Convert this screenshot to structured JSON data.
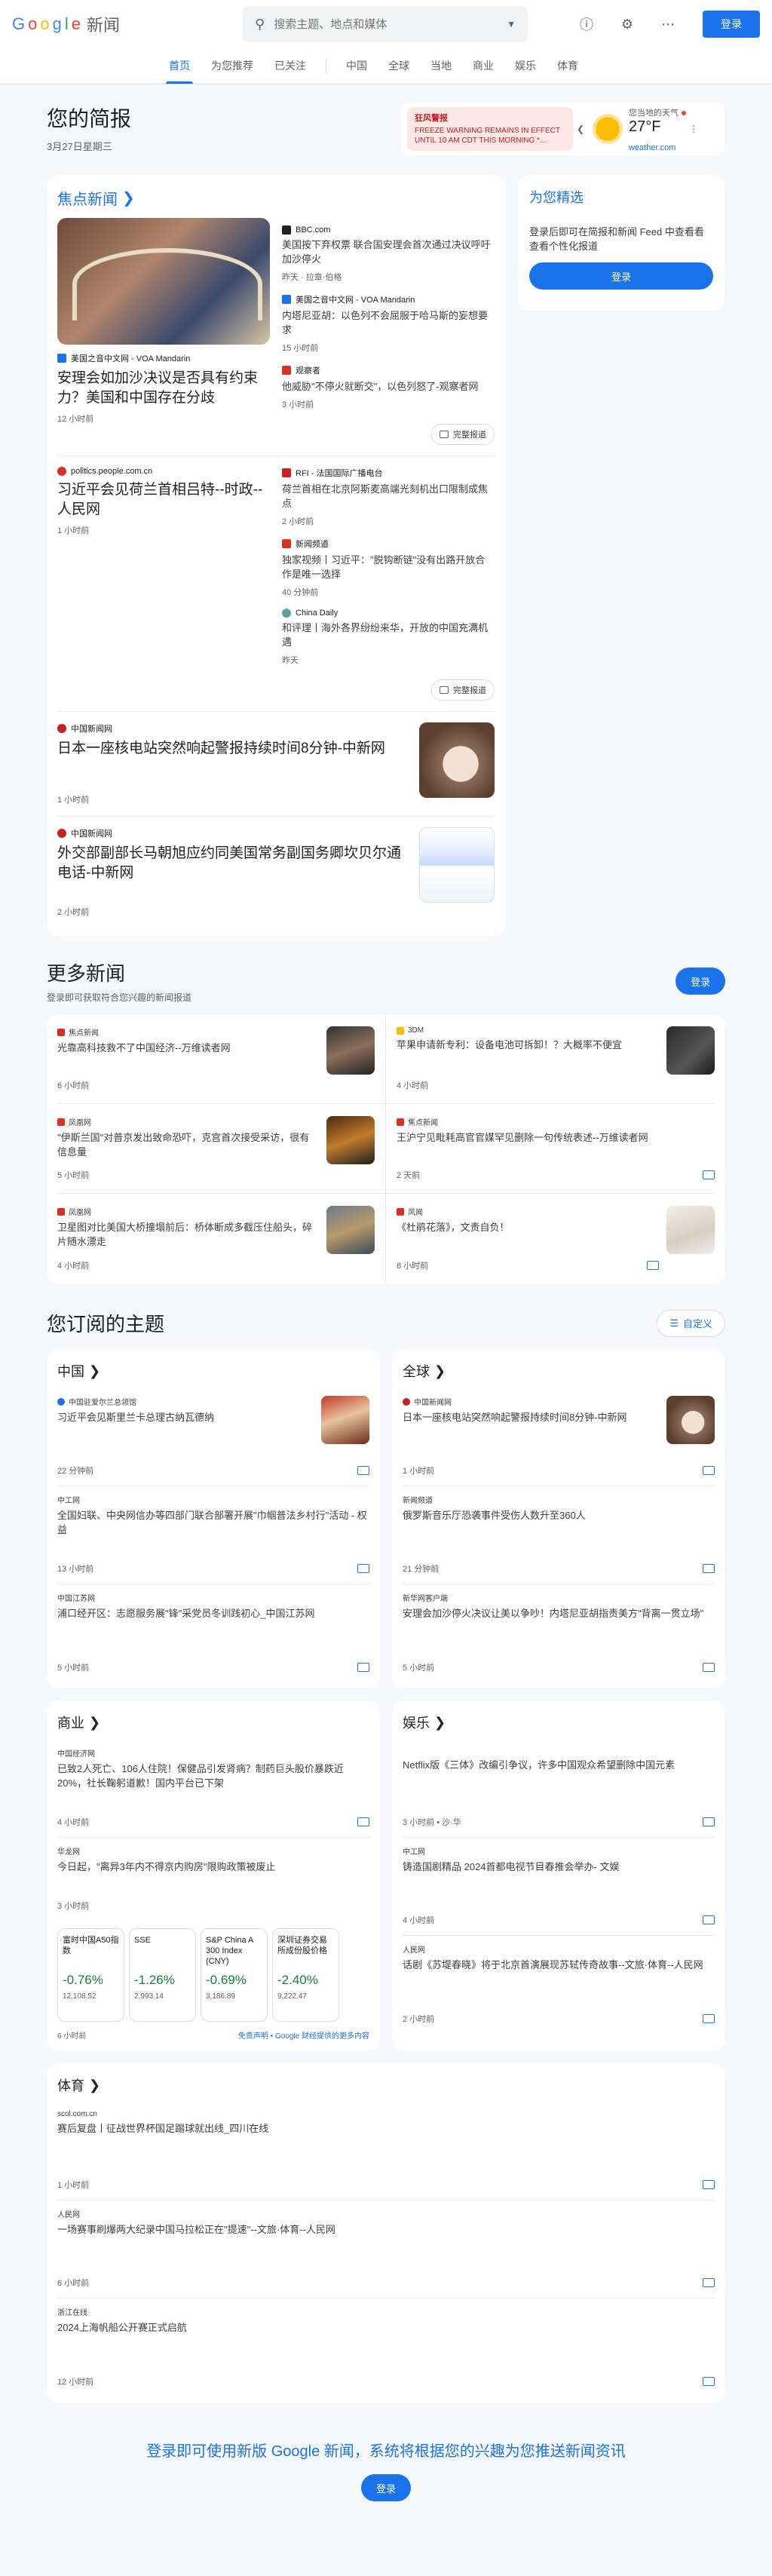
{
  "header": {
    "logo_google": [
      "G",
      "o",
      "o",
      "g",
      "l",
      "e"
    ],
    "logo_news": "新闻",
    "search_placeholder": "搜索主题、地点和媒体",
    "signin": "登录"
  },
  "nav": {
    "tabs": [
      "首页",
      "为您推荐",
      "已关注"
    ],
    "sections": [
      "中国",
      "全球",
      "当地",
      "商业",
      "娱乐",
      "体育"
    ]
  },
  "brief": {
    "title": "您的简报",
    "date": "3月27日星期三",
    "alert_label": "狂风警报",
    "alert_text": "FREEZE WARNING REMAINS IN EFFECT UNTIL 10 AM CDT THIS MORNING *...",
    "weather_label": "您当地的天气",
    "temp": "27°F",
    "weather_src": "weather.com"
  },
  "top_news": {
    "title": "焦点新闻",
    "full_coverage": "完整报道",
    "story1": {
      "main": {
        "source": "美国之音中文网 - VOA Mandarin",
        "headline": "安理会如加沙决议是否具有约束力？美国和中国存在分歧",
        "time": "12 小时前"
      },
      "side": [
        {
          "source": "BBC.com",
          "headline": "美国按下弃权票 联合国安理会首次通过决议呼吁加沙停火",
          "time": "昨天 · 拉章·伯格"
        },
        {
          "source": "美国之音中文网 - VOA Mandarin",
          "headline": "内塔尼亚胡：以色列不会屈服于哈马斯的妄想要求",
          "time": "15 小时前"
        },
        {
          "source": "观察者",
          "headline": "他威胁\"不停火就断交\"，以色列怒了-观察者网",
          "time": "3 小时前"
        }
      ]
    },
    "story2": {
      "main": {
        "source": "politics.people.com.cn",
        "headline": "习近平会见荷兰首相吕特--时政--人民网",
        "time": "1 小时前"
      },
      "side": [
        {
          "source": "RFI - 法国国际广播电台",
          "headline": "荷兰首相在北京阿斯麦高端光刻机出口限制成焦点",
          "time": "2 小时前"
        },
        {
          "source": "新闻频道",
          "headline": "独家视频丨习近平：\"脱钩断链\"没有出路开放合作是唯一选择",
          "time": "40 分钟前"
        },
        {
          "source": "China Daily",
          "headline": "和评理丨海外各界纷纷来华，开放的中国充满机遇",
          "time": "昨天"
        }
      ]
    },
    "story3": {
      "source": "中国新闻网",
      "headline": "日本一座核电站突然响起警报持续时间8分钟-中新网",
      "time": "1 小时前"
    },
    "story4": {
      "source": "中国新闻网",
      "headline": "外交部副部长马朝旭应约同美国常务副国务卿坎贝尔通电话-中新网",
      "time": "2 小时前"
    }
  },
  "picks": {
    "title": "为您精选",
    "desc": "登录后即可在简报和新闻 Feed 中查看看查看个性化报道",
    "button": "登录"
  },
  "more": {
    "title": "更多新闻",
    "subtitle": "登录即可获取符合您兴趣的新闻报道",
    "button": "登录",
    "items": [
      {
        "source": "焦点新闻",
        "headline": "光靠高科技救不了中国经济--万维读者网",
        "time": "6 小时前"
      },
      {
        "source": "3DM",
        "headline": "苹果申请新专利：设备电池可拆卸！？大概率不便宜",
        "time": "4 小时前"
      },
      {
        "source": "凤凰网",
        "headline": "\"伊斯兰国\"对普京发出致命恐吓，克宫首次接受采访，很有信息量",
        "time": "5 小时前"
      },
      {
        "source": "焦点新闻",
        "headline": "王沪宁见毗耗高官官媒罕见删除一句传统表述--万维读者网",
        "time": "2 天前"
      },
      {
        "source": "凤凰网",
        "headline": "卫星图对比美国大桥撞塌前后：桥体断成多截压住船头，碎片随水漂走",
        "time": "4 小时前"
      },
      {
        "source": "风闻",
        "headline": "《杜鹃花落》，文责自负！",
        "time": "8 小时前"
      }
    ]
  },
  "topics": {
    "title": "您订阅的主题",
    "customize": "自定义",
    "china": {
      "title": "中国",
      "items": [
        {
          "source": "中国驻爱尔兰总领馆",
          "headline": "习近平会见斯里兰卡总理古纳瓦德纳",
          "time": "22 分钟前"
        },
        {
          "source": "中工网",
          "headline": "全国妇联、中央网信办等四部门联合部署开展\"巾帼普法乡村行\"活动 - 权益",
          "time": "13 小时前"
        },
        {
          "source": "中国江苏网",
          "headline": "浦口经开区：志愿服务展\"锋\"采党员冬训践初心_中国江苏网",
          "time": "5 小时前"
        }
      ]
    },
    "world": {
      "title": "全球",
      "items": [
        {
          "source": "中国新闻网",
          "headline": "日本一座核电站突然响起警报持续时间8分钟-中新网",
          "time": "1 小时前"
        },
        {
          "source": "新闻频道",
          "headline": "俄罗斯音乐厅恐袭事件受伤人数升至360人",
          "time": "21 分钟前"
        },
        {
          "source": "新华网客户端",
          "headline": "安理会加沙停火决议让美以争吵！内塔尼亚胡指责美方\"背离一贯立场\"",
          "time": "5 小时前"
        }
      ]
    },
    "business": {
      "title": "商业",
      "items": [
        {
          "source": "中国经济网",
          "headline": "已致2人死亡、106人住院！保健品引发肾病？制药巨头股价暴跌近20%，社长鞠躬道歉！国内平台已下架",
          "time": "4 小时前"
        },
        {
          "source": "华龙网",
          "headline": "今日起，\"离异3年内不得京内购房\"限购政策被废止",
          "time": "3 小时前"
        }
      ],
      "stocks": [
        {
          "name": "富时中国A50指数",
          "change": "-0.76%",
          "value": "12,108.52"
        },
        {
          "name": "SSE",
          "change": "-1.26%",
          "value": "2,993.14"
        },
        {
          "name": "S&P China A 300 Index (CNY)",
          "change": "-0.69%",
          "value": "3,186.89"
        },
        {
          "name": "深圳证券交易所成份股价格",
          "change": "-2.40%",
          "value": "9,222.47"
        }
      ],
      "stock_time": "6 小时前",
      "disclaimer": "免责声明 • Google 财经提供的更多内容"
    },
    "entertainment": {
      "title": "娱乐",
      "items": [
        {
          "source": "",
          "headline": "Netflix版《三体》改编引争议，许多中国观众希望删除中国元素",
          "time": "3 小时前 • 沙·华"
        },
        {
          "source": "中工网",
          "headline": "铸造国剧精品 2024首都电视节目春推会举办- 文娱",
          "time": "4 小时前"
        },
        {
          "source": "人民网",
          "headline": "话剧《苏堤春晓》将于北京首演展现苏轼传奇故事--文旅·体育--人民网",
          "time": "2 小时前"
        }
      ]
    },
    "sports": {
      "title": "体育",
      "items": [
        {
          "source": "scol.com.cn",
          "headline": "赛后复盘丨征战世界杯国足踢球就出线_四川在线",
          "time": "1 小时前"
        },
        {
          "source": "人民网",
          "headline": "一场赛事刷爆两大纪录中国马拉松正在\"提速\"--文旅·体育--人民网",
          "time": "6 小时前"
        },
        {
          "source": "浙江在线",
          "headline": "2024上海帆船公开赛正式启航",
          "time": "12 小时前"
        }
      ]
    }
  },
  "footer": {
    "text": "登录即可使用新版 Google 新闻，系统将根据您的兴趣为您推送新闻资讯",
    "button": "登录"
  },
  "colors": {
    "accent": "#1a73e8",
    "alert": "#c5221f",
    "positive": "#188038"
  }
}
